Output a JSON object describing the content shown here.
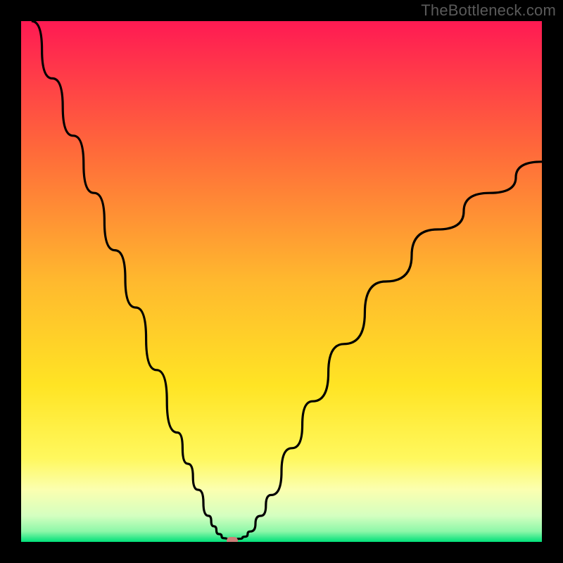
{
  "watermark": "TheBottleneck.com",
  "chart_data": {
    "type": "line",
    "title": "",
    "xlabel": "",
    "ylabel": "",
    "xlim": [
      0,
      100
    ],
    "ylim": [
      0,
      100
    ],
    "series": [
      {
        "name": "bottleneck-curve",
        "x": [
          2,
          6,
          10,
          14,
          18,
          22,
          26,
          30,
          32,
          34,
          36,
          37,
          38,
          39,
          40,
          41,
          42,
          43,
          44,
          46,
          48,
          52,
          56,
          62,
          70,
          80,
          90,
          100
        ],
        "values": [
          100,
          89,
          78,
          67,
          56,
          45,
          33,
          21,
          15,
          10,
          5,
          3,
          1.5,
          0.7,
          0.5,
          0.5,
          0.6,
          1,
          2,
          5,
          9,
          18,
          27,
          38,
          50,
          60,
          67,
          73
        ]
      }
    ],
    "marker": {
      "x": 40.5,
      "y": 0.3
    },
    "gradient_stops": [
      {
        "pct": 0,
        "color": "#ff1a53"
      },
      {
        "pct": 25,
        "color": "#ff6a3a"
      },
      {
        "pct": 50,
        "color": "#ffb92e"
      },
      {
        "pct": 70,
        "color": "#ffe424"
      },
      {
        "pct": 84,
        "color": "#fff85e"
      },
      {
        "pct": 90,
        "color": "#fbffb0"
      },
      {
        "pct": 95,
        "color": "#d4ffc0"
      },
      {
        "pct": 98,
        "color": "#8cf7a8"
      },
      {
        "pct": 100,
        "color": "#00e079"
      }
    ]
  }
}
